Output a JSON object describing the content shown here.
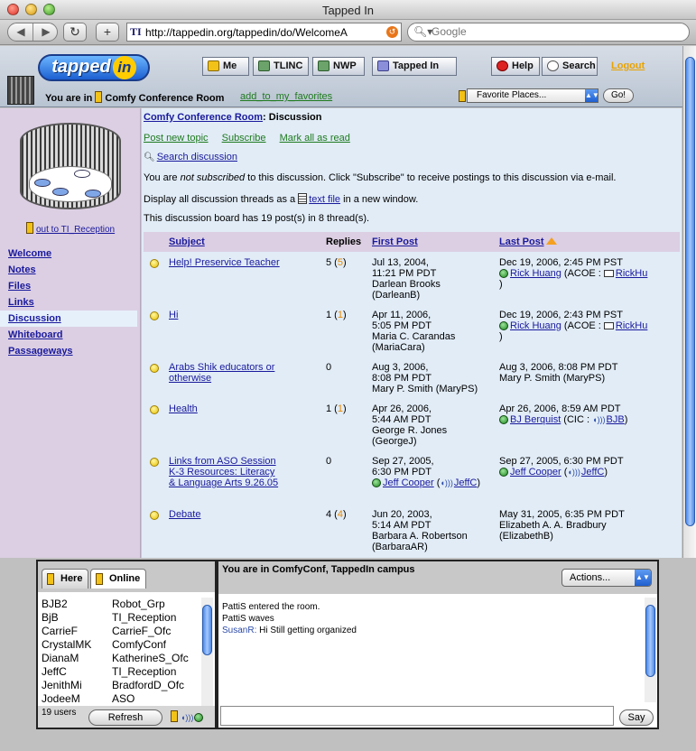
{
  "window": {
    "title": "Tapped In"
  },
  "browser": {
    "favicon": "TI",
    "url": "http://tappedin.org/tappedin/do/WelcomeA",
    "search_placeholder": "Google"
  },
  "header": {
    "logo_text": "tapped",
    "logo_in": "in",
    "tabs": [
      {
        "label": "Me",
        "icon": "folder-icon"
      },
      {
        "label": "TLINC",
        "icon": "folder-icon"
      },
      {
        "label": "NWP",
        "icon": "folder-icon"
      },
      {
        "label": "Tapped In",
        "icon": "folder-icon"
      }
    ],
    "help_label": "Help",
    "search_label": "Search",
    "logout_label": "Logout",
    "you_are_in_label": "You are in",
    "room_name": "Comfy Conference Room",
    "add_favorites_label": "add_to_my_favorites",
    "favorites_select": "Favorite Places...",
    "go_label": "Go!"
  },
  "sidebar": {
    "out_link": "out to TI_Reception",
    "items": [
      {
        "label": "Welcome",
        "active": false
      },
      {
        "label": "Notes",
        "active": false
      },
      {
        "label": "Files",
        "active": false
      },
      {
        "label": "Links",
        "active": false
      },
      {
        "label": "Discussion",
        "active": true
      },
      {
        "label": "Whiteboard",
        "active": false
      },
      {
        "label": "Passageways",
        "active": false
      }
    ]
  },
  "main": {
    "crumb_room": "Comfy Conference Room",
    "crumb_section": ": Discussion",
    "actions": [
      "Post new topic",
      "Subscribe",
      "Mark all as read"
    ],
    "search_discussion": "Search discussion",
    "sub_note_pre": "You are ",
    "sub_note_em": "not subscribed",
    "sub_note_post": " to this discussion. Click \"Subscribe\" to receive postings to this discussion via e-mail.",
    "display_pre": "Display all discussion threads as a ",
    "display_link": "text file",
    "display_post": " in a new window.",
    "board_note": "This discussion board has 19 post(s) in 8 thread(s).",
    "columns": {
      "subject": "Subject",
      "replies": "Replies",
      "first": "First Post",
      "last": "Last Post"
    },
    "threads": [
      {
        "subject": "Help! Preservice Teacher",
        "replies": "5",
        "new": "5",
        "first": [
          "Jul 13, 2004,",
          "11:21 PM PDT",
          "Darlean Brooks",
          "(DarleanB)"
        ],
        "last_date": "Dec 19, 2006, 2:45 PM PST",
        "last_name": "Rick Huang",
        "last_org": " (ACOE : ",
        "last_user": "RickHu",
        "last_close": ")"
      },
      {
        "subject": "Hi",
        "replies": "1",
        "new": "1",
        "first": [
          "Apr 11, 2006,",
          "5:05 PM PDT",
          "Maria C. Carandas",
          "(MariaCara)"
        ],
        "last_date": "Dec 19, 2006, 2:43 PM PST",
        "last_name": "Rick Huang",
        "last_org": " (ACOE : ",
        "last_user": "RickHu",
        "last_close": ")"
      },
      {
        "subject": "Arabs Shik educators or otherwise",
        "replies": "0",
        "new": "",
        "first": [
          "Aug 3, 2006,",
          "8:08 PM PDT",
          "Mary P. Smith (MaryPS)"
        ],
        "last_plain": [
          "Aug 3, 2006, 8:08 PM PDT",
          "Mary P. Smith (MaryPS)"
        ]
      },
      {
        "subject": "Health",
        "replies": "1",
        "new": "1",
        "first": [
          "Apr 26, 2006,",
          "5:44 AM PDT",
          "George R. Jones",
          "(GeorgeJ)"
        ],
        "last_date": "Apr 26, 2006, 8:59 AM PDT",
        "last_name": "BJ Berquist",
        "last_org": " (CIC : ",
        "last_user": "BJB",
        "last_close": ")"
      },
      {
        "subject": "Links from ASO Session K-3 Resources: Literacy & Language Arts 9.26.05",
        "replies": "0",
        "new": "",
        "first": [
          "Sep 27, 2005,",
          "6:30 PM PDT"
        ],
        "first_name": "Jeff Cooper",
        "first_user": "JeffC",
        "last_date": "Sep 27, 2005, 6:30 PM PDT",
        "last_name": "Jeff Cooper",
        "last_org": " (",
        "last_user": "JeffC",
        "last_close": ")"
      },
      {
        "subject": "Debate",
        "replies": "4",
        "new": "4",
        "first": [
          "Jun 20, 2003,",
          "5:14 AM PDT",
          "Barbara A. Robertson",
          "(BarbaraAR)"
        ],
        "last_plain": [
          "May 31, 2005, 6:35 PM PDT",
          "Elizabeth A. A. Bradbury",
          "(ElizabethB)"
        ]
      }
    ]
  },
  "chat": {
    "tabs": [
      "Here",
      "Online"
    ],
    "users_col1": [
      "BJB2",
      "BjB",
      "CarrieF",
      "CrystalMK",
      "DianaM",
      "JeffC",
      "JenithMi",
      "JodeeM"
    ],
    "users_col2": [
      "Robot_Grp",
      "TI_Reception",
      "CarrieF_Ofc",
      "ComfyConf",
      "KatherineS_Ofc",
      "TI_Reception",
      "BradfordD_Ofc",
      "ASO"
    ],
    "user_count": "19 users",
    "refresh_label": "Refresh",
    "location": "You are in ComfyConf, TappedIn campus",
    "actions_label": "Actions...",
    "messages": [
      {
        "who": "PattiS",
        "text": " entered the room.",
        "blue": false
      },
      {
        "who": "PattiS",
        "text": " waves",
        "blue": false
      },
      {
        "who": "SusanR:",
        "text": " Hi Still getting organized",
        "blue": true
      }
    ],
    "input_value": "",
    "say_label": "Say"
  }
}
